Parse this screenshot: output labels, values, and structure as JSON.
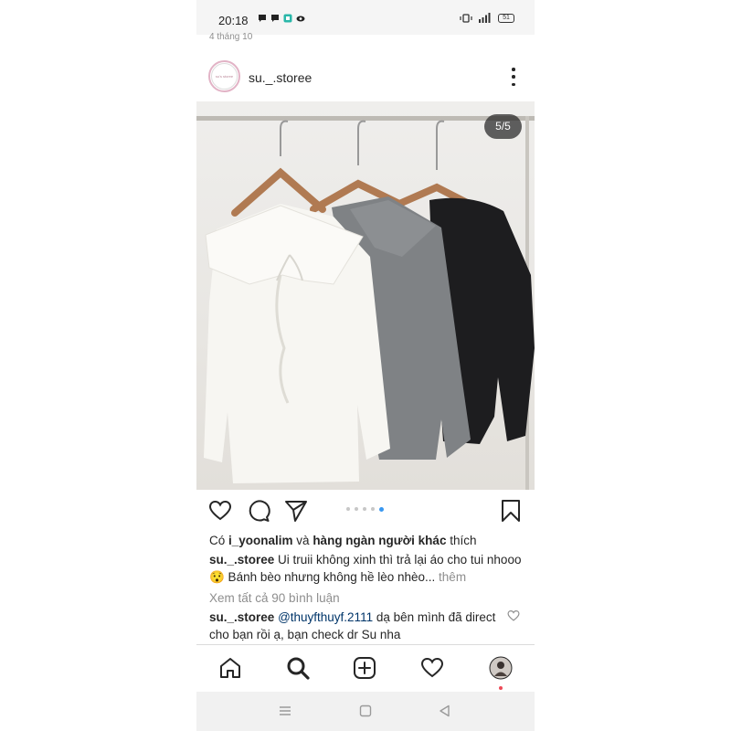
{
  "status_bar": {
    "time": "20:18",
    "battery": "51"
  },
  "feed": {
    "date_above": "4 tháng 10"
  },
  "post": {
    "username": "su._.storee",
    "avatar_text": "su's storee",
    "image_counter": "5/5",
    "carousel": {
      "count": 5,
      "active_index": 4
    },
    "likes": {
      "prefix": "Có ",
      "user": "i_yoonalim",
      "middle": " và ",
      "others": "hàng ngàn người khác",
      "suffix": " thích"
    },
    "caption": {
      "user": "su._.storee",
      "text": " Ui truii không xinh thì trả lại áo cho tui nhooo 😯 Bánh bèo nhưng không hề lèo nhèo...",
      "more": " thêm"
    },
    "view_comments": "Xem tất cả 90 bình luận",
    "comment": {
      "user": "su._.storee",
      "mention": "@thuyfthuyf.2111",
      "text": " dạ bên mình đã direct cho bạn rồi ạ, bạn check dr Su nha"
    }
  },
  "icons": {
    "like": "heart-icon",
    "comment": "comment-icon",
    "share": "send-icon",
    "save": "bookmark-icon",
    "home": "home-icon",
    "search": "search-icon",
    "new_post": "add-post-icon",
    "activity": "heart-icon",
    "profile": "profile-avatar"
  },
  "colors": {
    "accent_blue": "#3897f0",
    "text": "#262626",
    "secondary": "#8e8e8e",
    "link": "#003569",
    "notification": "#ed4956"
  }
}
